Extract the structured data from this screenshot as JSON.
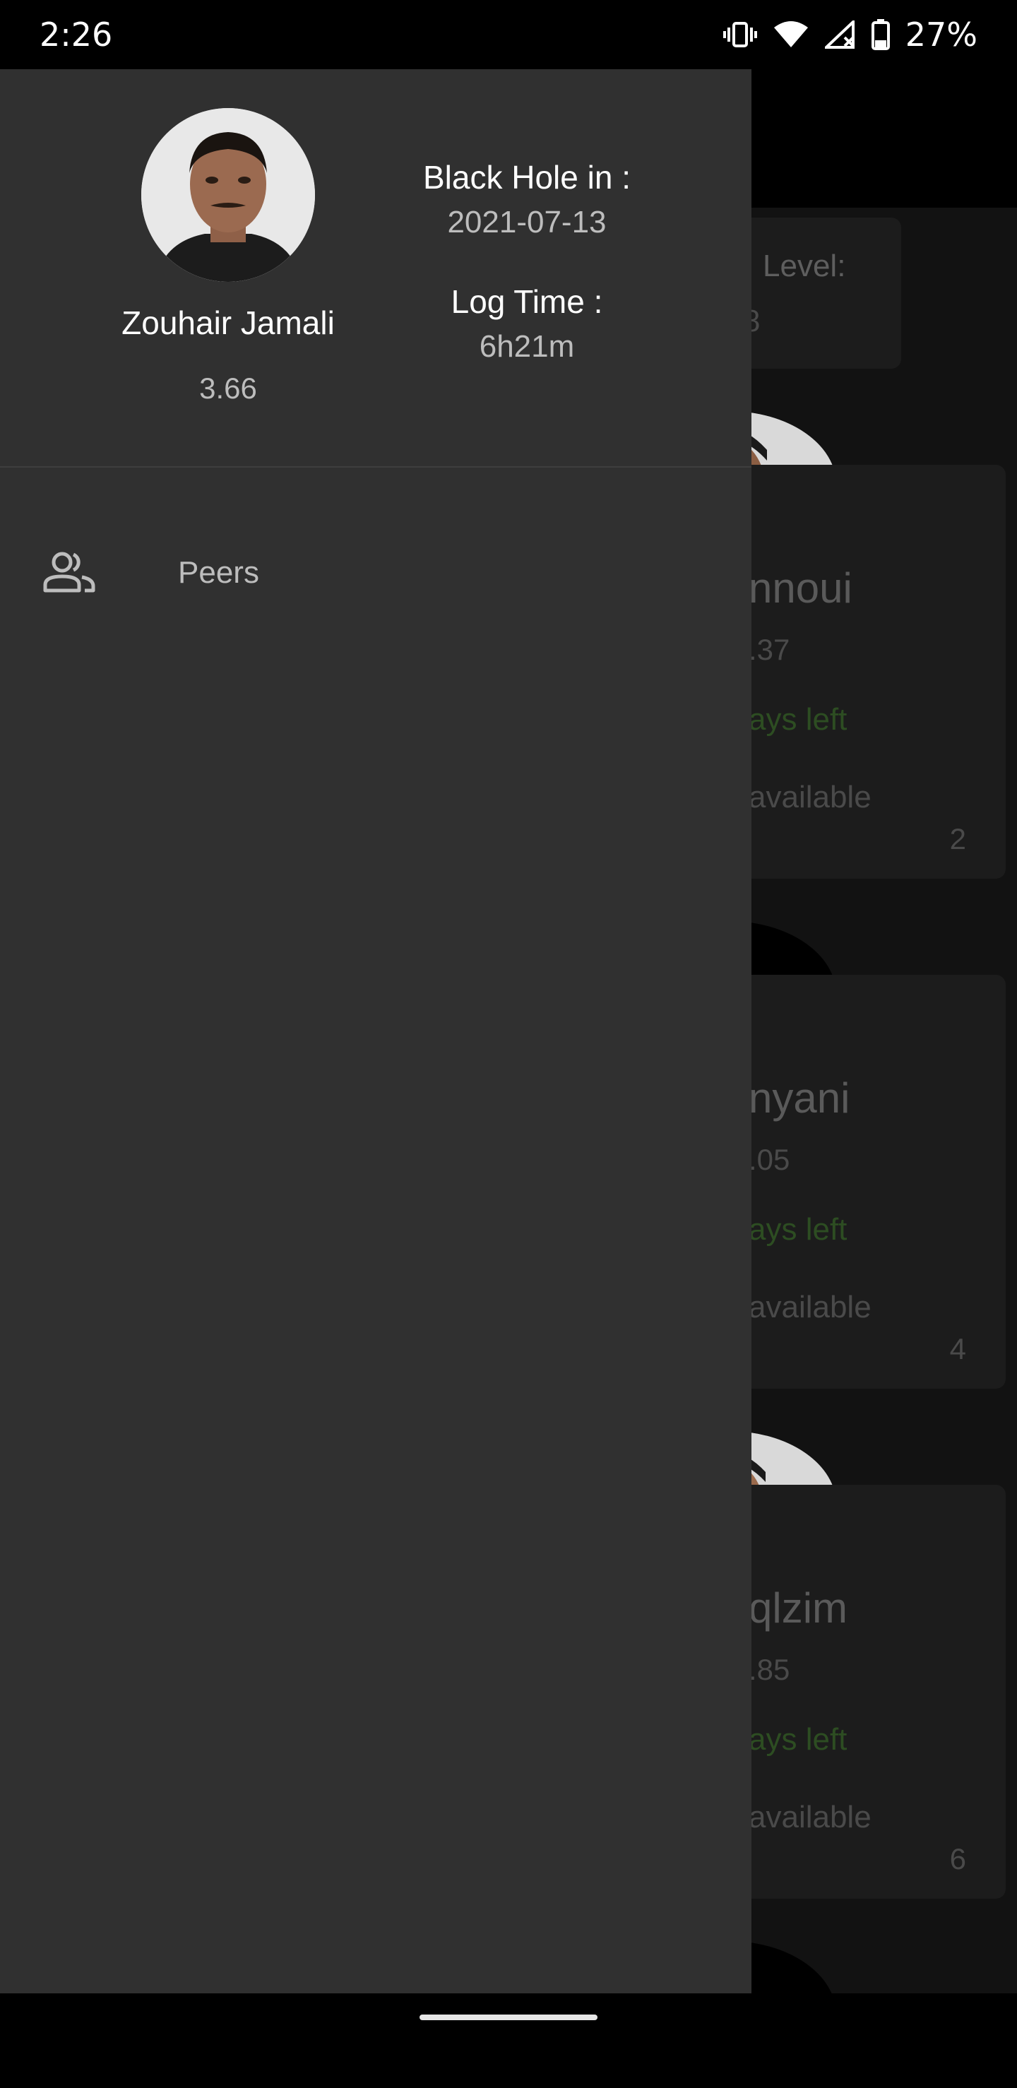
{
  "status_bar": {
    "time": "2:26",
    "battery_percent": "27%",
    "icons": [
      "vibrate-icon",
      "wifi-icon",
      "signal-off-icon",
      "battery-icon"
    ]
  },
  "background_app": {
    "level_card": {
      "label": "Level:",
      "value": "8"
    },
    "peers": [
      {
        "name": "nnoui",
        "gpa": ".37",
        "days": "ays left",
        "status": "available",
        "level": "2",
        "avatar": "photo"
      },
      {
        "name": "nyani",
        "gpa": ".05",
        "days": "ays left",
        "status": "available",
        "level": "4",
        "avatar": "black"
      },
      {
        "name": "qlzim",
        "gpa": ".85",
        "days": "ays left",
        "status": "available",
        "level": "6",
        "avatar": "photo"
      }
    ]
  },
  "drawer": {
    "profile": {
      "name": "Zouhair Jamali",
      "gpa": "3.66"
    },
    "black_hole": {
      "label": "Black Hole in :",
      "value": "2021-07-13"
    },
    "log_time": {
      "label": "Log Time :",
      "value": "6h21m"
    },
    "menu": [
      {
        "label": "Peers",
        "icon": "people-icon"
      }
    ]
  },
  "colors": {
    "drawer_bg": "#303030",
    "page_bg": "#121212",
    "muted_text": "#bdbdbd",
    "days_left_green": "#2d4d22"
  }
}
